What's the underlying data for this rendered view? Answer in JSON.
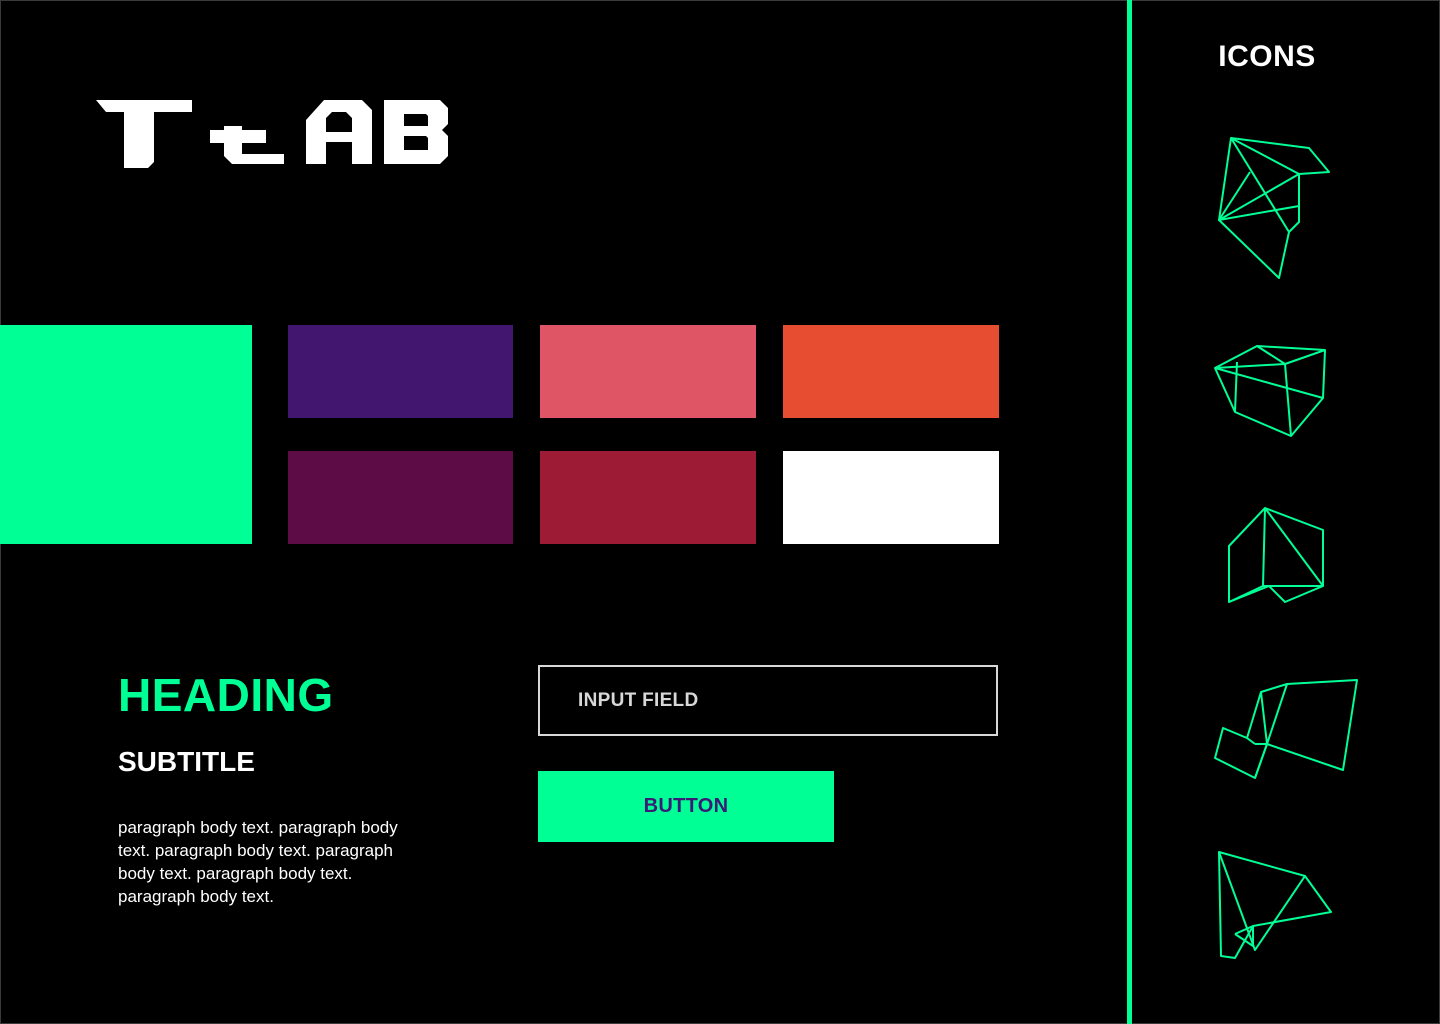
{
  "brand": {
    "logo_text": "T-LAB"
  },
  "colors": {
    "accent": "#00ff95",
    "palette": [
      {
        "name": "green",
        "hex": "#00ff95"
      },
      {
        "name": "purple",
        "hex": "#42166f"
      },
      {
        "name": "pink",
        "hex": "#df5566"
      },
      {
        "name": "orange",
        "hex": "#e64d31"
      },
      {
        "name": "plum",
        "hex": "#5e0c45"
      },
      {
        "name": "crimson",
        "hex": "#9e1b35"
      },
      {
        "name": "white",
        "hex": "#ffffff"
      }
    ]
  },
  "typography": {
    "heading": "HEADING",
    "subtitle": "SUBTITLE",
    "paragraph": "paragraph body text. paragraph body text. paragraph body text. paragraph body text. paragraph body text. paragraph body text."
  },
  "form": {
    "input_placeholder": "INPUT FIELD",
    "button_label": "BUTTON"
  },
  "icons_panel": {
    "title": "ICONS",
    "items": [
      {
        "icon": "polygon-bird-icon"
      },
      {
        "icon": "polygon-cube-icon"
      },
      {
        "icon": "polygon-gem-icon"
      },
      {
        "icon": "polygon-kite-icon"
      },
      {
        "icon": "polygon-plane-icon"
      }
    ]
  }
}
